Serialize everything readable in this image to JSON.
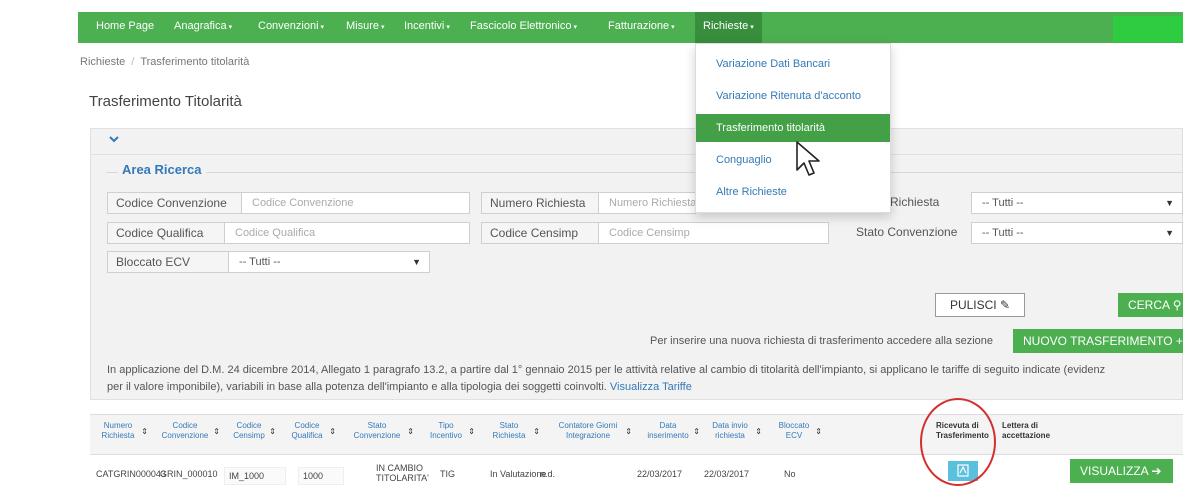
{
  "navbar": {
    "items": [
      {
        "label": "Home Page",
        "caret": false
      },
      {
        "label": "Anagrafica",
        "caret": true
      },
      {
        "label": "Convenzioni",
        "caret": true
      },
      {
        "label": "Misure",
        "caret": true
      },
      {
        "label": "Incentivi",
        "caret": true
      },
      {
        "label": "Fascicolo Elettronico",
        "caret": true
      },
      {
        "label": "Fatturazione",
        "caret": true
      },
      {
        "label": "Richieste",
        "caret": true,
        "active": true
      }
    ],
    "caret_glyph": "▾"
  },
  "breadcrumb": {
    "parent": "Richieste",
    "separator": "/",
    "current": "Trasferimento titolarità"
  },
  "page_title": "Trasferimento Titolarità",
  "panel": {
    "toggle_icon": "chevron-down-icon",
    "legend": "Area Ricerca",
    "fields": {
      "codice_convenzione": {
        "label": "Codice Convenzione",
        "placeholder": "Codice Convenzione"
      },
      "numero_richiesta": {
        "label": "Numero Richiesta",
        "placeholder": "Numero Richiesta"
      },
      "stato_richiesta": {
        "label": "Richiesta",
        "value": "-- Tutti --"
      },
      "codice_qualifica": {
        "label": "Codice Qualifica",
        "placeholder": "Codice Qualifica"
      },
      "codice_censimp": {
        "label": "Codice Censimp",
        "placeholder": "Codice Censimp"
      },
      "stato_convenzione": {
        "label": "Stato Convenzione",
        "value": "-- Tutti --"
      },
      "bloccato_ecv": {
        "label": "Bloccato ECV",
        "value": "-- Tutti --"
      }
    },
    "buttons": {
      "pulisci": "PULISCI",
      "cerca": "CERCA"
    },
    "info_text": "Per inserire una nuova richiesta di trasferimento accedere alla sezione",
    "nuovo_button": "NUOVO TRASFERIMENTO"
  },
  "notice": {
    "line1": "In applicazione del D.M. 24 dicembre 2014, Allegato 1 paragrafo 13.2, a partire dal 1° gennaio 2015 per le attività relative al cambio di titolarità dell'impianto, si applicano le tariffe di seguito indicate (evidenz",
    "line2": "per il valore imponibile), variabili in base alla potenza dell'impianto e alla tipologia dei soggetti coinvolti.",
    "link": "Visualizza Tariffe"
  },
  "table": {
    "headers": [
      "Numero Richiesta",
      "Codice Convenzione",
      "Codice Censimp",
      "Codice Qualifica",
      "Stato Convenzione",
      "Tipo Incentivo",
      "Stato Richiesta",
      "Contatore Giorni Integrazione",
      "Data inserimento",
      "Data invio richiesta",
      "Bloccato ECV",
      "Ricevuta di Trasferimento",
      "Lettera di accettazione"
    ],
    "sort_glyph": "⇕",
    "rows": [
      {
        "numero_richiesta": "CATGRIN000043",
        "codice_convenzione": "GRIN_000010",
        "codice_censimp": "IM_1000",
        "codice_qualifica": "1000",
        "stato_convenzione": "IN CAMBIO TITOLARITA'",
        "tipo_incentivo": "TIG",
        "stato_richiesta": "In Valutazione",
        "contatore": "n.d.",
        "data_inserimento": "22/03/2017",
        "data_invio": "22/03/2017",
        "bloccato_ecv": "No",
        "visualizza": "VISUALIZZA"
      }
    ]
  },
  "dropdown": {
    "items": [
      {
        "label": "Variazione Dati Bancari"
      },
      {
        "label": "Variazione Ritenuta d'acconto"
      },
      {
        "label": "Trasferimento titolarità",
        "active": true
      },
      {
        "label": "Conguaglio"
      },
      {
        "label": "Altre Richieste"
      }
    ]
  },
  "icons": {
    "pulisci": "eraser-icon",
    "cerca": "search-icon",
    "nuovo": "plus-icon",
    "ricevuta": "document-icon",
    "visualizza": "arrow-right-icon"
  },
  "colors": {
    "green": "#4caf50",
    "link": "#337ab7",
    "annotation": "#d32f2f"
  }
}
